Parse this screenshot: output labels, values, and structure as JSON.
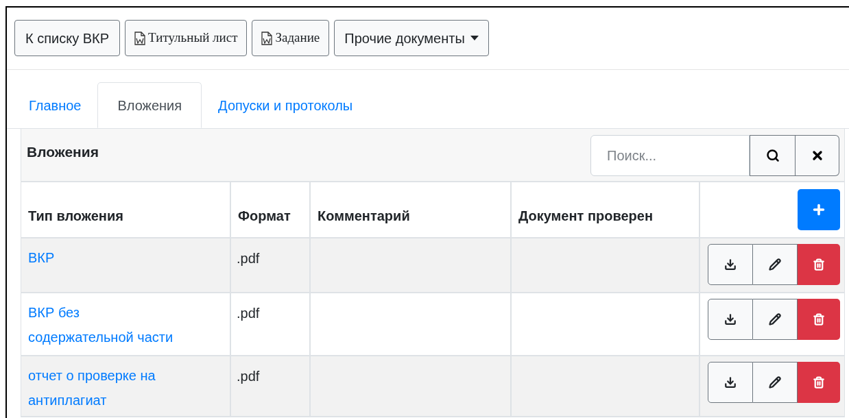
{
  "toolbar": [
    {
      "kind": "plain",
      "label": "К списку ВКР"
    },
    {
      "kind": "word",
      "label": "Титульный лист"
    },
    {
      "kind": "word",
      "label": "Задание"
    },
    {
      "kind": "dropdown",
      "label": "Прочие документы"
    }
  ],
  "tabs": [
    {
      "label": "Главное",
      "selected": false
    },
    {
      "label": "Вложения",
      "selected": true
    },
    {
      "label": "Допуски и протоколы",
      "selected": false
    }
  ],
  "panel": {
    "title": "Вложения",
    "search": {
      "placeholder": "Поиск..."
    }
  },
  "table": {
    "columns": [
      "Тип вложения",
      "Формат",
      "Комментарий",
      "Документ проверен"
    ],
    "rows": [
      {
        "type": "ВКР",
        "format": ".pdf"
      },
      {
        "type": "ВКР без содержательной части",
        "format": ".pdf"
      },
      {
        "type": "отчет о проверке на антиплагиат",
        "format": ".pdf"
      }
    ]
  }
}
